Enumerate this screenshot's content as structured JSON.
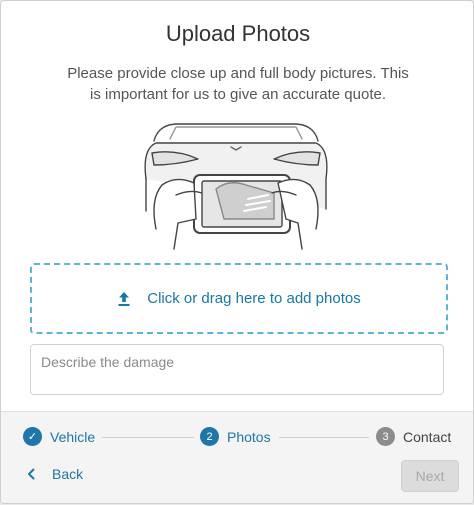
{
  "header": {
    "title": "Upload Photos",
    "subtitle": "Please provide close up and full body pictures. This is important for us to give an accurate quote."
  },
  "upload": {
    "label": "Click or drag here to add photos",
    "icon": "upload-icon"
  },
  "damage_field": {
    "placeholder": "Describe the damage",
    "value": ""
  },
  "steps": [
    {
      "marker": "✓",
      "label": "Vehicle",
      "state": "complete",
      "icon": "check-icon"
    },
    {
      "marker": "2",
      "label": "Photos",
      "state": "active"
    },
    {
      "marker": "3",
      "label": "Contact",
      "state": "upcoming"
    }
  ],
  "navigation": {
    "back_label": "Back",
    "next_label": "Next",
    "next_disabled": true
  },
  "colors": {
    "accent": "#1f76a8",
    "dropzone_border": "#5db4d8",
    "disabled_bg": "#dcdcdc",
    "upcoming_step": "#8c8c8c"
  }
}
